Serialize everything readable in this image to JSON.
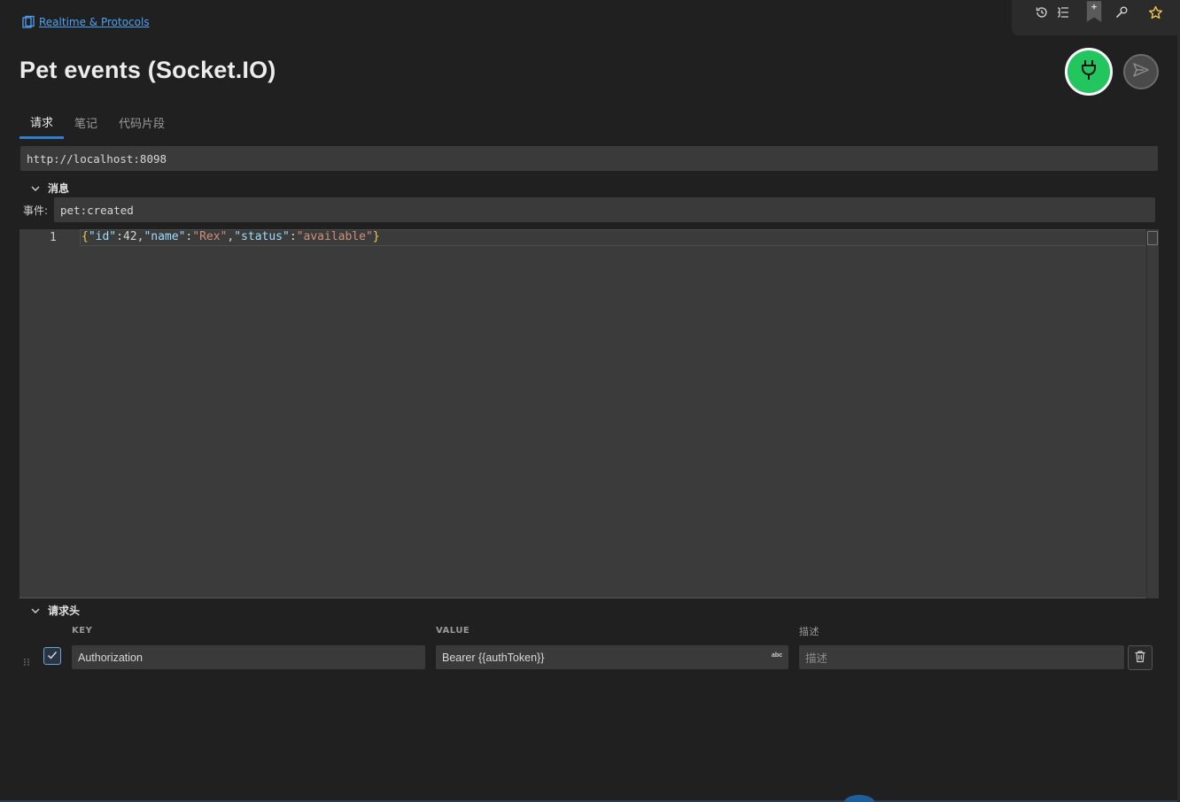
{
  "breadcrumb": {
    "label": "Realtime & Protocols"
  },
  "toolbar": {
    "history_icon": "history-icon",
    "outline_icon": "list-outline-icon",
    "bookmark_icon": "bookmark-add-icon",
    "settings_icon": "wrench-icon",
    "favorite_icon": "star-icon"
  },
  "page": {
    "title": "Pet events (Socket.IO)"
  },
  "actions": {
    "connect_icon": "plug-icon",
    "send_icon": "send-icon",
    "connect_color": "#22c55e"
  },
  "tabs": [
    {
      "label": "请求",
      "active": true
    },
    {
      "label": "笔记",
      "active": false
    },
    {
      "label": "代码片段",
      "active": false
    }
  ],
  "url": {
    "value": "http://localhost:8098"
  },
  "message": {
    "section_label": "消息",
    "event_label": "事件:",
    "event_value": "pet:created",
    "editor": {
      "line_number": "1",
      "tokens": [
        "{",
        "\"id\"",
        ":",
        "42",
        ",",
        "\"name\"",
        ":",
        "\"Rex\"",
        ",",
        "\"status\"",
        ":",
        "\"available\"",
        "}"
      ]
    }
  },
  "headers": {
    "section_label": "请求头",
    "columns": {
      "key": "KEY",
      "value": "VALUE",
      "description": "描述"
    },
    "rows": [
      {
        "enabled": true,
        "key": "Authorization",
        "value": "Bearer {{authToken}}",
        "value_badge": "abc",
        "description_placeholder": "描述"
      }
    ]
  },
  "colors": {
    "accent": "#2f7fd1",
    "link": "#4ea1f3",
    "background": "#202020"
  }
}
